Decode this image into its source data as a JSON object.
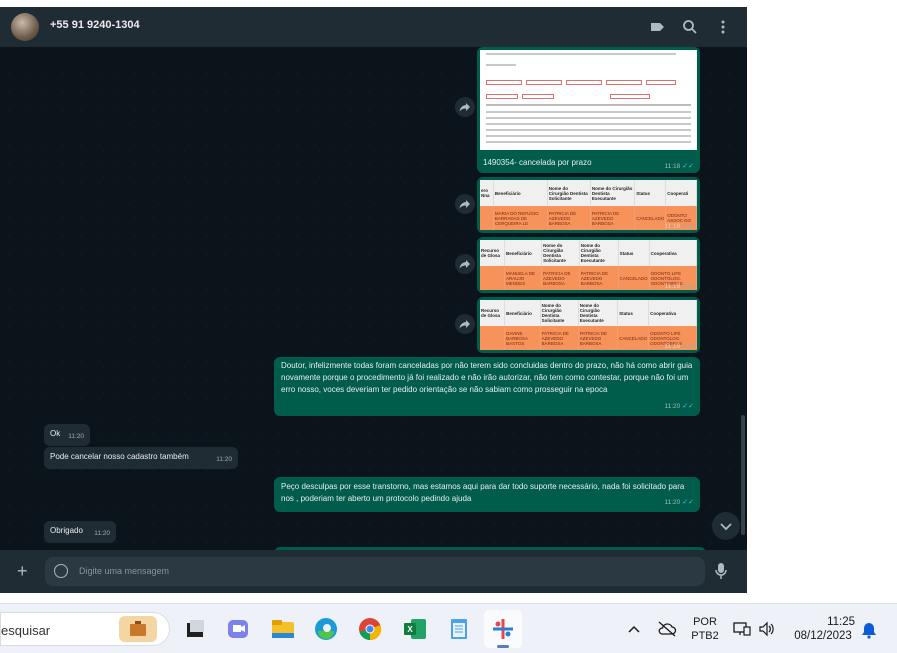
{
  "header": {
    "contact_name": "+55 91 9240-1304",
    "icons": [
      "label-icon",
      "search-icon",
      "more-vertical-icon"
    ]
  },
  "messages": {
    "m1": {
      "caption": "1490354- cancelada por prazo",
      "time": "11:18"
    },
    "m2": {
      "time": "11:18",
      "headers": [
        "ero Nna",
        "Beneficiário",
        "Nome do Cirurgião Dentista Solicitante",
        "Nome do Cirurgião Dentista Executante",
        "Status",
        "Cooperati"
      ],
      "row": [
        "",
        "MARIA DO REFUGIO BARRADAS DE CERQUEIRA LE",
        "PATRICIA DE AZEVEDO BARBOSA",
        "PATRICIA DE AZEVEDO BARBOSA",
        "CANCELADO",
        "ODONTO ASSOC DO"
      ]
    },
    "m3": {
      "time": "11:19",
      "headers": [
        "Recurso de Glosa",
        "Beneficiário",
        "Nome do Cirurgião Dentista Solicitante",
        "Nome do Cirurgião Dentista Executante",
        "Status",
        "Cooperativa"
      ],
      "row": [
        "",
        "MANUELA DE ARAUJO MENDES",
        "PATRICIA DE AZEVEDO BARBOSA",
        "PATRICIA DE AZEVEDO BARBOSA",
        "CANCELADO",
        "ODONTO LIFE ODONTOLOG. ODONTOBRAS"
      ]
    },
    "m4": {
      "time": "11:19",
      "headers": [
        "Recurso de Glosa",
        "Beneficiário",
        "Nome do Cirurgião Dentista Solicitante",
        "Nome do Cirurgião Dentista Executante",
        "Status",
        "Cooperativa"
      ],
      "row": [
        "",
        "DAVINE BARBOSA BASTOS",
        "PATRICIA DE AZEVEDO BARBOSA",
        "PATRICIA DE AZEVEDO BARBOSA",
        "CANCELADO",
        "ODONTO LIFE ODONTOLOG. ODONTOBRAS"
      ]
    },
    "m5": {
      "text": "Doutor, infelizmente todas foram canceladas por não terem sido concluidas dentro do prazo, não há como abrir guia novamente porque o procedimento já foi realizado e não irão autorizar, não tem como contestar, porque não foi um erro nosso, voces deveriam ter pedido orientação se não sabiam como prosseguir na epoca",
      "time": "11:20"
    },
    "m6": {
      "text": "Ok",
      "time": "11:20"
    },
    "m7": {
      "text": "Pode cancelar nosso cadastro também",
      "time": "11:20"
    },
    "m8": {
      "text": "Peço desculpas por esse transtorno, mas estamos aqui para dar todo suporte necessário, nada foi solicitado para nos , poderiam ter aberto um protocolo pedindo ajuda",
      "time": "11:20"
    },
    "m9": {
      "text": "Obrigado",
      "time": "11:20"
    }
  },
  "composer": {
    "placeholder": "Digite uma mensagem"
  },
  "taskbar": {
    "search_text": "esquisar",
    "language": "POR",
    "layout": "PTB2",
    "time": "11:25",
    "date": "08/12/2023"
  },
  "colors": {
    "outgoing": "#005c4b",
    "incoming": "#202c33",
    "background": "#0b141a",
    "header": "#202c33",
    "read_check": "#53bdeb"
  }
}
